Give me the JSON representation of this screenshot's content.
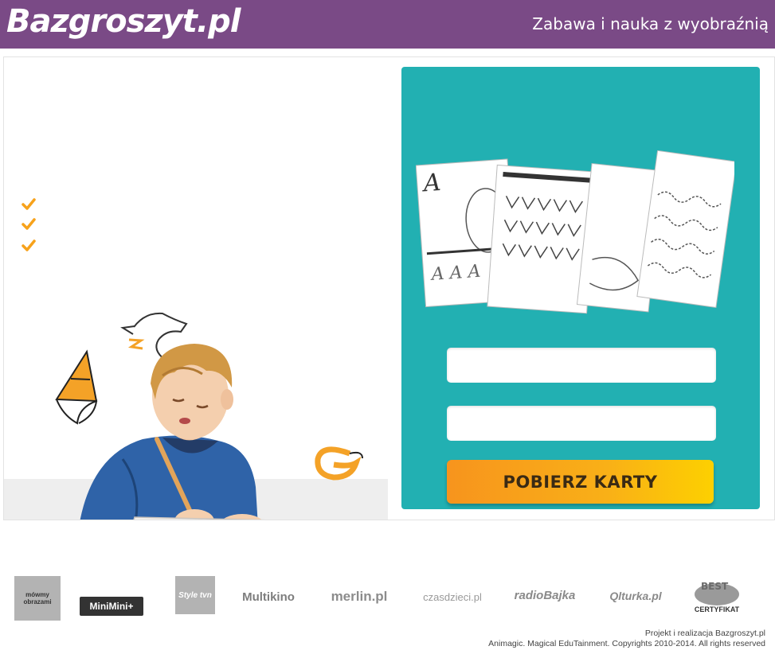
{
  "header": {
    "logo": "Bazgroszyt.pl",
    "tagline": "Zabawa i nauka z wyobraźnią",
    "background": "#7a4a86"
  },
  "hero": {
    "check_color": "#f7a21b"
  },
  "form": {
    "card_color": "#22b0b2",
    "submit_label": "POBIERZ KARTY",
    "submit_color": "#f9a51a"
  },
  "partners": [
    {
      "name": "mowmy-obrazami",
      "label": "mówmy obrazami"
    },
    {
      "name": "minimini",
      "label": "MiniMini+"
    },
    {
      "name": "style-tvn",
      "label": "Style tvn"
    },
    {
      "name": "multikino",
      "label": "Multikino"
    },
    {
      "name": "merlin",
      "label": "merlin.pl"
    },
    {
      "name": "czas-dzieci",
      "label": "czasdzieci.pl"
    },
    {
      "name": "radio-bajka",
      "label": "radioBajka"
    },
    {
      "name": "qlturka",
      "label": "Qlturka.pl"
    },
    {
      "name": "best-certyfikat",
      "label": "CERTYFIKAT"
    }
  ],
  "footer": {
    "line1": "Projekt i realizacja Bazgroszyt.pl",
    "line2": "Animagic. Magical EduTainment. Copyrights 2010-2014. All rights reserved"
  }
}
